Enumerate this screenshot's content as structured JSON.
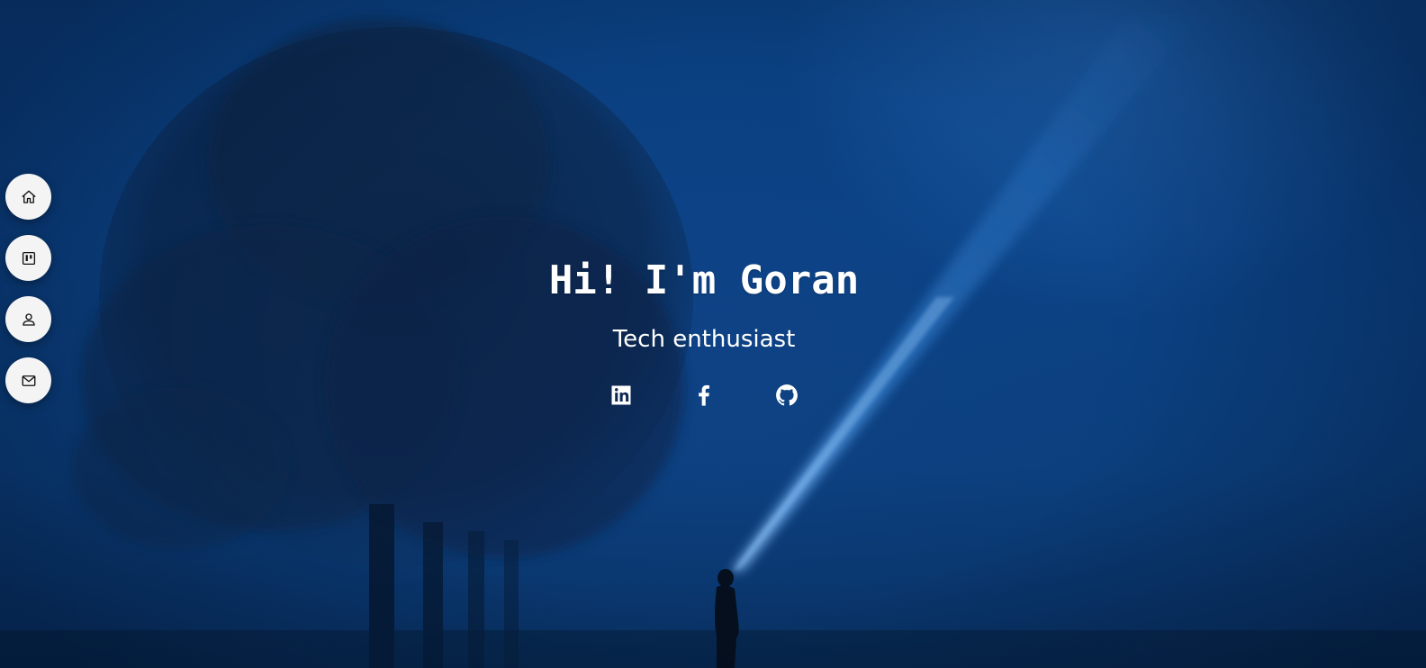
{
  "hero": {
    "title": "Hi! I'm Goran",
    "subtitle": "Tech enthusiast"
  },
  "sidenav": {
    "items": [
      {
        "name": "home",
        "icon": "home-icon"
      },
      {
        "name": "portfolio",
        "icon": "board-icon"
      },
      {
        "name": "about",
        "icon": "user-icon"
      },
      {
        "name": "contact",
        "icon": "mail-icon"
      }
    ]
  },
  "socials": [
    {
      "name": "linkedin",
      "icon": "linkedin-icon"
    },
    {
      "name": "facebook",
      "icon": "facebook-icon"
    },
    {
      "name": "github",
      "icon": "github-icon"
    }
  ],
  "colors": {
    "background": "#0b4285",
    "nav_button": "#f4f4f5",
    "text": "#ffffff",
    "beam": "#4a9be8"
  }
}
